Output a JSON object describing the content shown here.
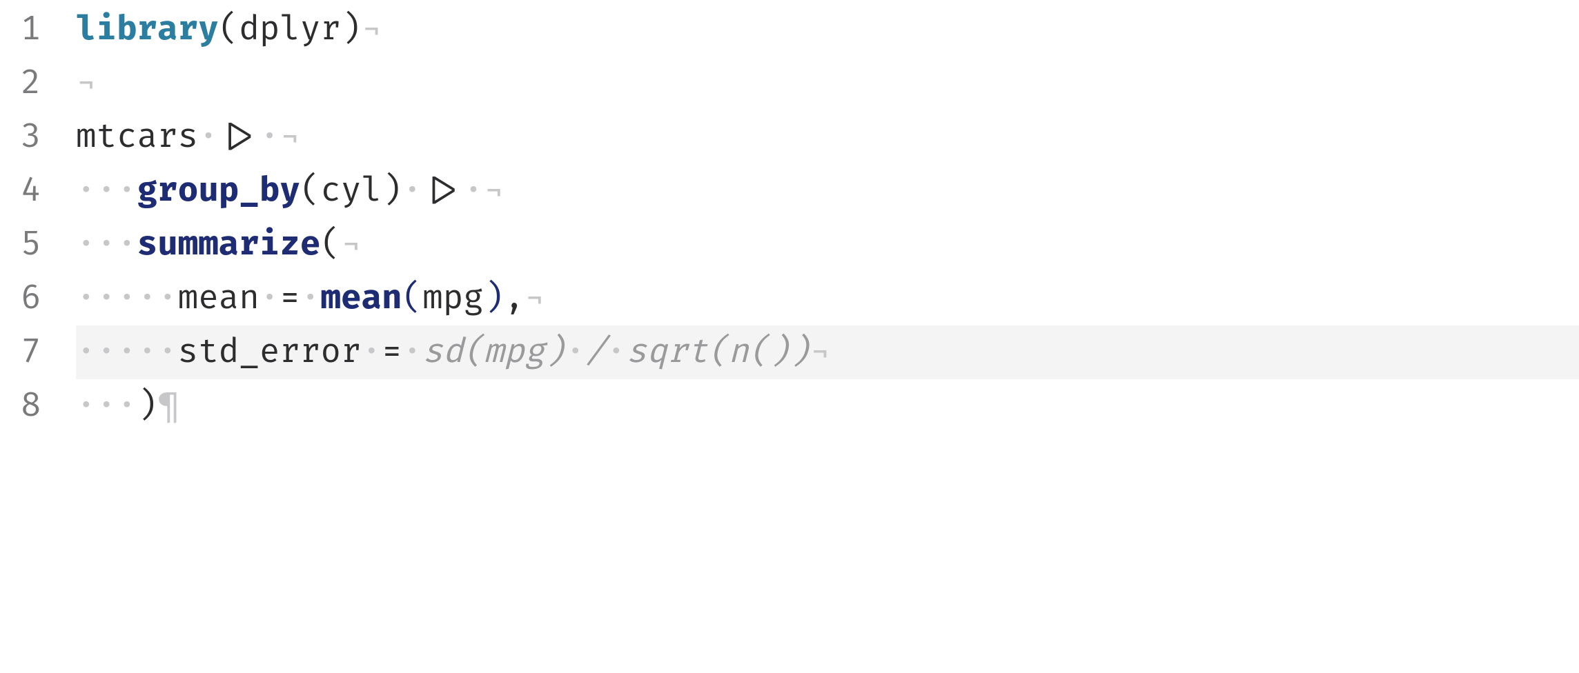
{
  "editor": {
    "highlighted_line": 7,
    "lines": [
      {
        "num": "1",
        "tokens": [
          {
            "t": "library",
            "cls": "kw-teal"
          },
          {
            "t": "(",
            "cls": "paren"
          },
          {
            "t": "dplyr",
            "cls": "txt"
          },
          {
            "t": ")",
            "cls": "paren"
          },
          {
            "t": "¬",
            "cls": "eol"
          }
        ]
      },
      {
        "num": "2",
        "tokens": [
          {
            "t": "¬",
            "cls": "eol"
          }
        ]
      },
      {
        "num": "3",
        "tokens": [
          {
            "t": "mtcars",
            "cls": "txt"
          },
          {
            "t": "·",
            "cls": "ws"
          },
          {
            "t": "|>",
            "cls": "txt"
          },
          {
            "t": "·",
            "cls": "ws"
          },
          {
            "t": "¬",
            "cls": "eol"
          }
        ]
      },
      {
        "num": "4",
        "tokens": [
          {
            "t": "···",
            "cls": "ws"
          },
          {
            "t": "group_by",
            "cls": "kw-navy"
          },
          {
            "t": "(",
            "cls": "paren"
          },
          {
            "t": "cyl",
            "cls": "txt"
          },
          {
            "t": ")",
            "cls": "paren"
          },
          {
            "t": "·",
            "cls": "ws"
          },
          {
            "t": "|>",
            "cls": "txt"
          },
          {
            "t": "·",
            "cls": "ws"
          },
          {
            "t": "¬",
            "cls": "eol"
          }
        ]
      },
      {
        "num": "5",
        "tokens": [
          {
            "t": "···",
            "cls": "ws"
          },
          {
            "t": "summarize",
            "cls": "kw-navy"
          },
          {
            "t": "(",
            "cls": "paren"
          },
          {
            "t": "¬",
            "cls": "eol"
          }
        ]
      },
      {
        "num": "6",
        "tokens": [
          {
            "t": "·····",
            "cls": "ws"
          },
          {
            "t": "mean",
            "cls": "txt"
          },
          {
            "t": "·",
            "cls": "ws"
          },
          {
            "t": "=",
            "cls": "txt"
          },
          {
            "t": "·",
            "cls": "ws"
          },
          {
            "t": "mean",
            "cls": "kw-navy"
          },
          {
            "t": "(",
            "cls": "kw-navy-paren"
          },
          {
            "t": "mpg",
            "cls": "txt"
          },
          {
            "t": ")",
            "cls": "kw-navy-paren"
          },
          {
            "t": ",",
            "cls": "txt"
          },
          {
            "t": "¬",
            "cls": "eol"
          }
        ]
      },
      {
        "num": "7",
        "tokens": [
          {
            "t": "·····",
            "cls": "ws"
          },
          {
            "t": "std_error",
            "cls": "txt"
          },
          {
            "t": "·",
            "cls": "ws"
          },
          {
            "t": "=",
            "cls": "txt"
          },
          {
            "t": "·",
            "cls": "ws"
          },
          {
            "t": "sd(mpg)",
            "cls": "ghost"
          },
          {
            "t": "·",
            "cls": "ws"
          },
          {
            "t": "/",
            "cls": "ghost"
          },
          {
            "t": "·",
            "cls": "ws"
          },
          {
            "t": "sqrt(n())",
            "cls": "ghost"
          },
          {
            "t": "¬",
            "cls": "eol"
          }
        ]
      },
      {
        "num": "8",
        "tokens": [
          {
            "t": "···",
            "cls": "ws"
          },
          {
            "t": ")",
            "cls": "paren"
          },
          {
            "t": "¶",
            "cls": "eol"
          }
        ]
      }
    ]
  }
}
